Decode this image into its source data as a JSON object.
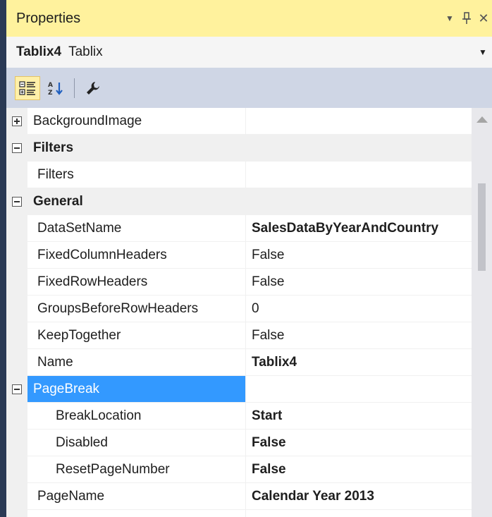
{
  "window": {
    "title": "Properties",
    "controls": {
      "dropdown_glyph": "▼",
      "pin_glyph": "🖈",
      "close_glyph": "✕"
    }
  },
  "object": {
    "name": "Tablix4",
    "type": "Tablix"
  },
  "toolbar": {
    "buttons": [
      {
        "icon": "categorized-icon",
        "active": true
      },
      {
        "icon": "alphabetical-icon",
        "active": false
      },
      {
        "icon": "property-pages-icon",
        "active": false
      }
    ]
  },
  "grid": {
    "rows": [
      {
        "kind": "prop-expandable",
        "expanded": false,
        "name": "BackgroundImage",
        "value": "",
        "bold": false
      },
      {
        "kind": "category",
        "expanded": true,
        "name": "Filters"
      },
      {
        "kind": "prop",
        "name": "Filters",
        "value": "",
        "bold": false
      },
      {
        "kind": "category",
        "expanded": true,
        "name": "General"
      },
      {
        "kind": "prop",
        "name": "DataSetName",
        "value": "SalesDataByYearAndCountry",
        "bold": true
      },
      {
        "kind": "prop",
        "name": "FixedColumnHeaders",
        "value": "False",
        "bold": false
      },
      {
        "kind": "prop",
        "name": "FixedRowHeaders",
        "value": "False",
        "bold": false
      },
      {
        "kind": "prop",
        "name": "GroupsBeforeRowHeaders",
        "value": "0",
        "bold": false
      },
      {
        "kind": "prop",
        "name": "KeepTogether",
        "value": "False",
        "bold": false
      },
      {
        "kind": "prop",
        "name": "Name",
        "value": "Tablix4",
        "bold": true
      },
      {
        "kind": "prop-expandable",
        "expanded": true,
        "selected": true,
        "name": "PageBreak",
        "value": "",
        "bold": false
      },
      {
        "kind": "sub",
        "name": "BreakLocation",
        "value": "Start",
        "bold": true
      },
      {
        "kind": "sub",
        "name": "Disabled",
        "value": "False",
        "bold": true
      },
      {
        "kind": "sub",
        "name": "ResetPageNumber",
        "value": "False",
        "bold": true
      },
      {
        "kind": "prop",
        "name": "PageName",
        "value": "Calendar Year 2013",
        "bold": true
      },
      {
        "kind": "prop",
        "name": "",
        "value": "",
        "bold": false
      }
    ]
  },
  "colors": {
    "title_bar": "#fff29d",
    "toolbar": "#cfd6e5",
    "selection": "#3399ff",
    "category_bg": "#f0f0f0",
    "left_edge": "#2b3a55"
  }
}
